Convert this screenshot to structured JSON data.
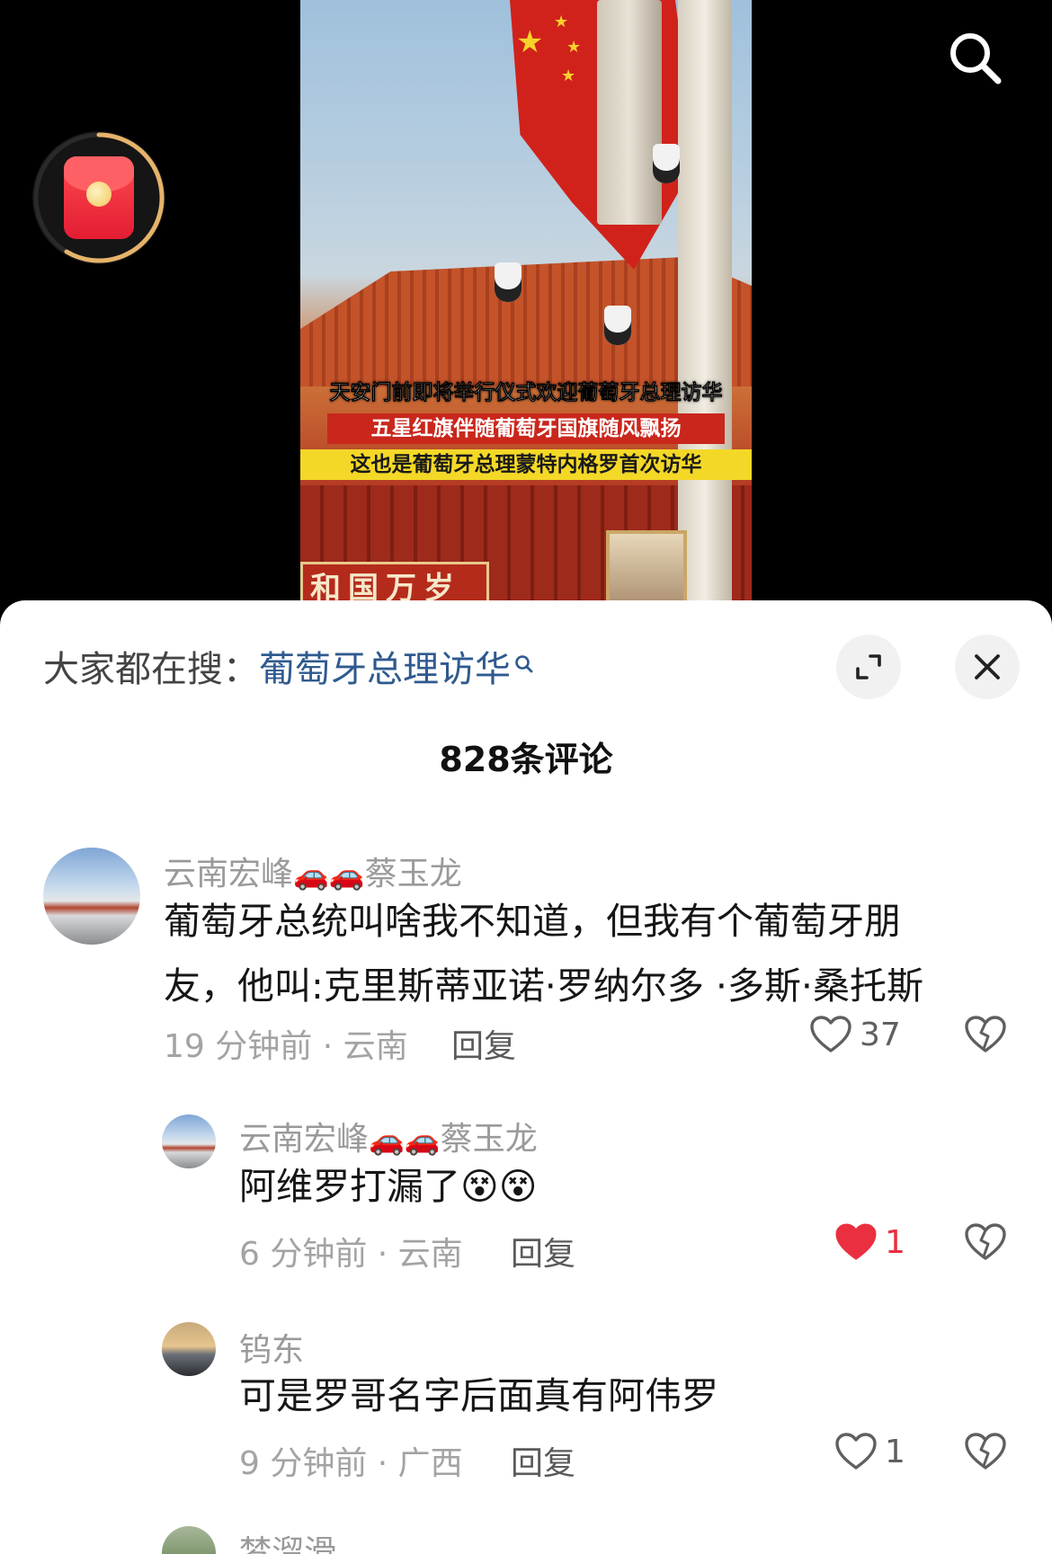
{
  "video": {
    "captions": [
      "天安门前即将举行仪式欢迎葡萄牙总理访华",
      "五星红旗伴随葡萄牙国旗随风飘扬",
      "这也是葡萄牙总理蒙特内格罗首次访华"
    ],
    "wall_text": "和国万岁"
  },
  "top_icons": {
    "search": "search-icon",
    "red_packet": "red-packet-icon"
  },
  "panel": {
    "trending_prefix": "大家都在搜：",
    "trending_keyword": "葡萄牙总理访华",
    "comment_count": "828条评论",
    "expand_icon": "expand-icon",
    "close_icon": "close-icon"
  },
  "comments": [
    {
      "user": "云南宏峰",
      "user_suffix": "蔡玉龙",
      "badges": [
        "🚗",
        "🚗"
      ],
      "lines": [
        "葡萄牙总统叫啥我不知道，但我有个葡萄牙朋",
        "友，他叫:克里斯蒂亚诺·罗纳尔多 ·多斯·桑托斯"
      ],
      "time": "19 分钟前 · 云南",
      "reply_label": "回复",
      "likes": "37",
      "liked": false
    },
    {
      "user": "云南宏峰",
      "user_suffix": "蔡玉龙",
      "badges": [
        "🚗",
        "🚗"
      ],
      "text": "阿维罗打漏了",
      "emojis": [
        "😵",
        "😵"
      ],
      "time": "6 分钟前 · 云南",
      "reply_label": "回复",
      "likes": "1",
      "liked": true
    },
    {
      "user": "钨东",
      "text": "可是罗哥名字后面真有阿伟罗",
      "time": "9 分钟前 · 广西",
      "reply_label": "回复",
      "likes": "1",
      "liked": false
    },
    {
      "user": "梦溜滑"
    }
  ],
  "colors": {
    "keyword": "#2f5a8f",
    "liked_heart": "#ea2f40",
    "meta_gray": "#a3a3a3",
    "red_packet": "#e31d33",
    "ring": "#e6b36a"
  }
}
